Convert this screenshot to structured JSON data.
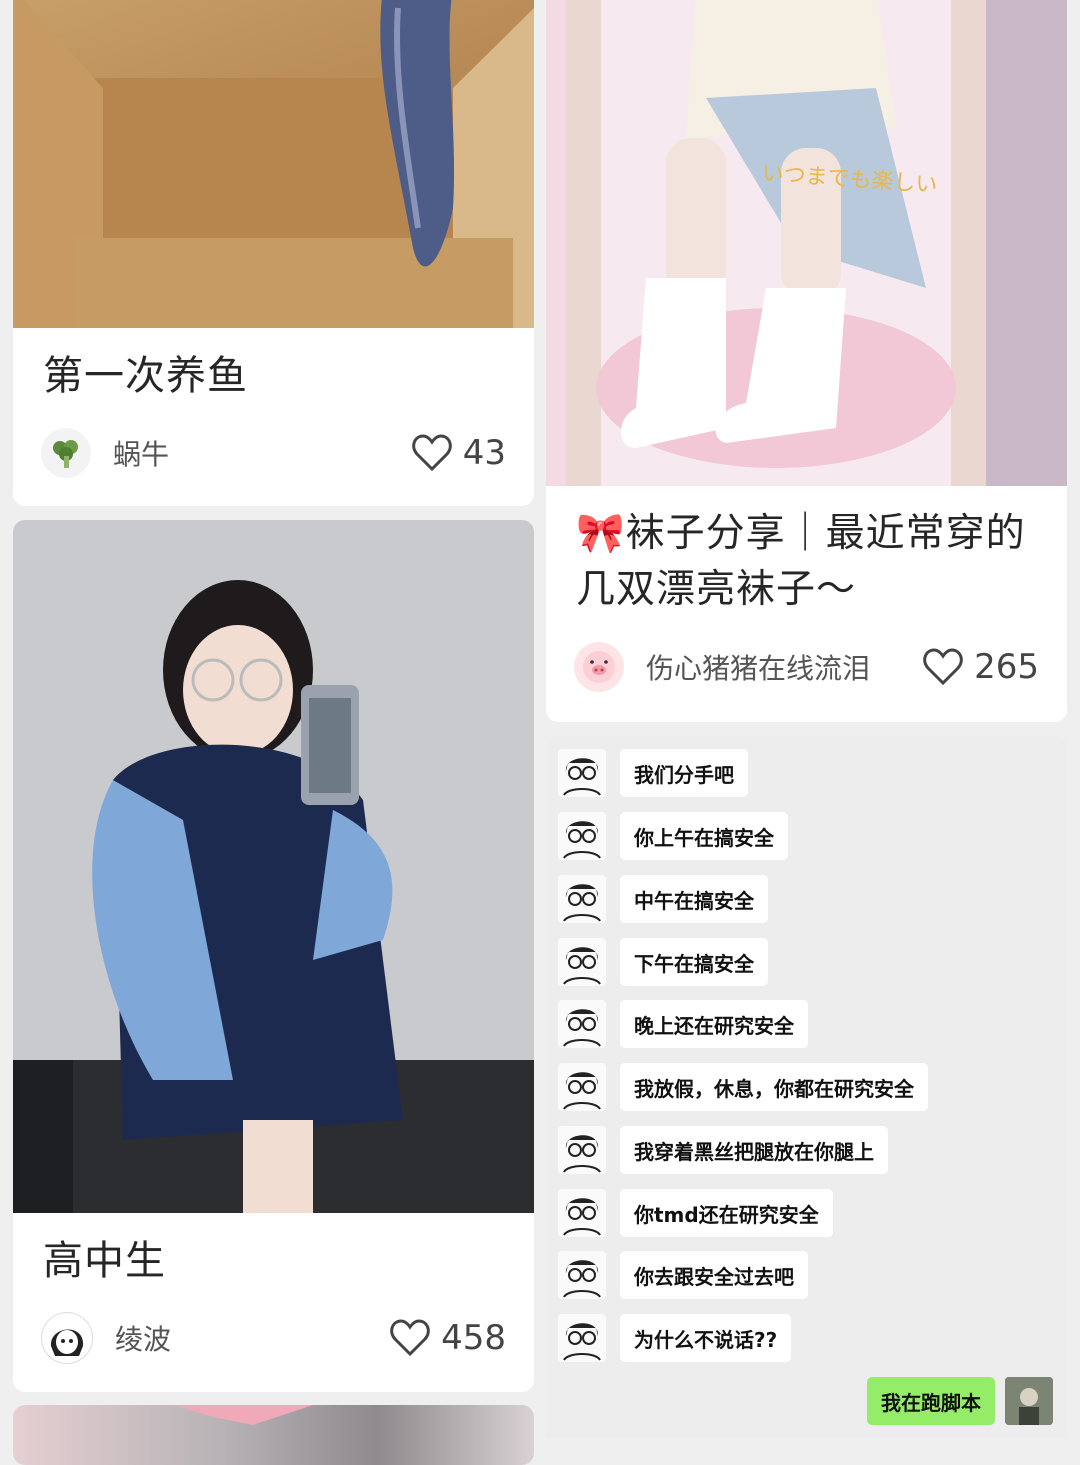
{
  "cards": [
    {
      "title": "第一次养鱼",
      "author": "蜗牛",
      "likes": "43",
      "avatar_icon": "broccoli-icon"
    },
    {
      "title": "高中生",
      "author": "绫波",
      "likes": "458",
      "avatar_icon": "anime-girl-avatar"
    },
    {
      "title_emoji": "🎀",
      "title": "袜子分享｜最近常穿的几双漂亮袜子～",
      "author": "伤心猪猪在线流泪",
      "likes": "265",
      "avatar_icon": "pig-face-icon",
      "image_caption": "いつまでも楽しい"
    }
  ],
  "chat": {
    "messages": [
      "我们分手吧",
      "你上午在搞安全",
      "中午在搞安全",
      "下午在搞安全",
      "晚上还在研究安全",
      "我放假，休息，你都在研究安全",
      "我穿着黑丝把腿放在你腿上",
      "你tmd还在研究安全",
      "你去跟安全过去吧",
      "为什么不说话??"
    ],
    "reply": "我在跑脚本"
  },
  "colors": {
    "background": "#efefef",
    "reply_bubble": "#95ec69",
    "card": "#ffffff"
  }
}
